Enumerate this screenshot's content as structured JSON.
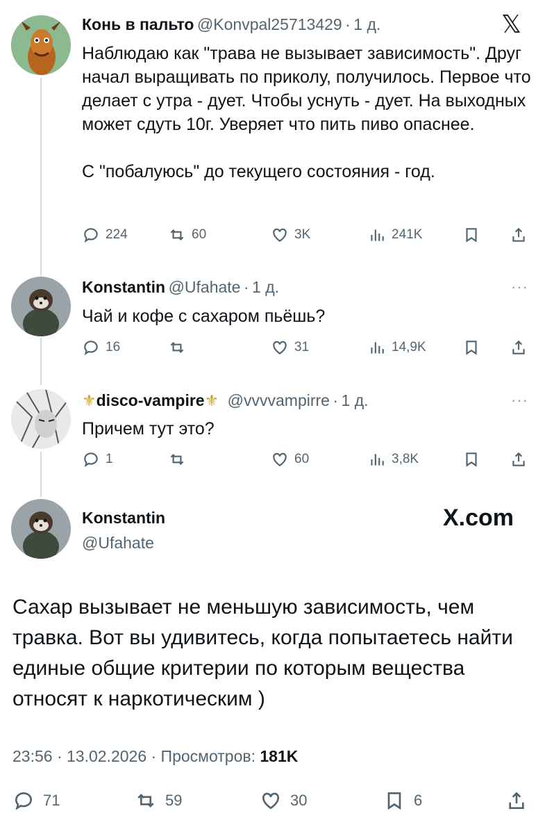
{
  "tweet1": {
    "name": "Конь в пальто",
    "handle": "@Konvpal25713429",
    "time": "1 д.",
    "text": "Наблюдаю как \"трава не вызывает зависимость\". Друг начал выращивать по приколу, получилось. Первое что делает с утра - дует. Чтобы уснуть - дует. На выходных может сдуть 10г. Уверяет что пить пиво опаснее.\n\nС \"побалуюсь\" до текущего состояния - год.",
    "replies": "224",
    "reposts": "60",
    "likes": "3K",
    "views": "241K"
  },
  "tweet2": {
    "name": "Konstantin",
    "handle": "@Ufahate",
    "time": "1 д.",
    "text": "Чай и кофе с сахаром пьёшь?",
    "replies": "16",
    "reposts": "",
    "likes": "31",
    "views": "14,9K"
  },
  "tweet3": {
    "name": "disco-vampire",
    "handle": "@vvvvampirre",
    "time": "1 д.",
    "text": "Причем тут это?",
    "replies": "1",
    "reposts": "",
    "likes": "60",
    "views": "3,8K"
  },
  "main": {
    "name": "Konstantin",
    "handle": "@Ufahate",
    "brand": "X.com",
    "text": "Сахар вызывает не меньшую зависимость, чем травка. Вот вы удивитесь, когда попытаетесь найти единые общие критерии по которым вещества относят к наркотическим )",
    "datetime": "23:56 · 13.02.2026 · Просмотров:",
    "views": "181K",
    "replies": "71",
    "reposts": "59",
    "likes": "30",
    "bookmarks": "6"
  },
  "separator": "·",
  "x_logo": "𝕏",
  "more": "···",
  "fleur": "⚜",
  "icons": [
    "reply-icon",
    "repost-icon",
    "like-icon",
    "views-icon",
    "bookmark-icon",
    "share-icon",
    "x-logo-icon",
    "more-icon"
  ]
}
